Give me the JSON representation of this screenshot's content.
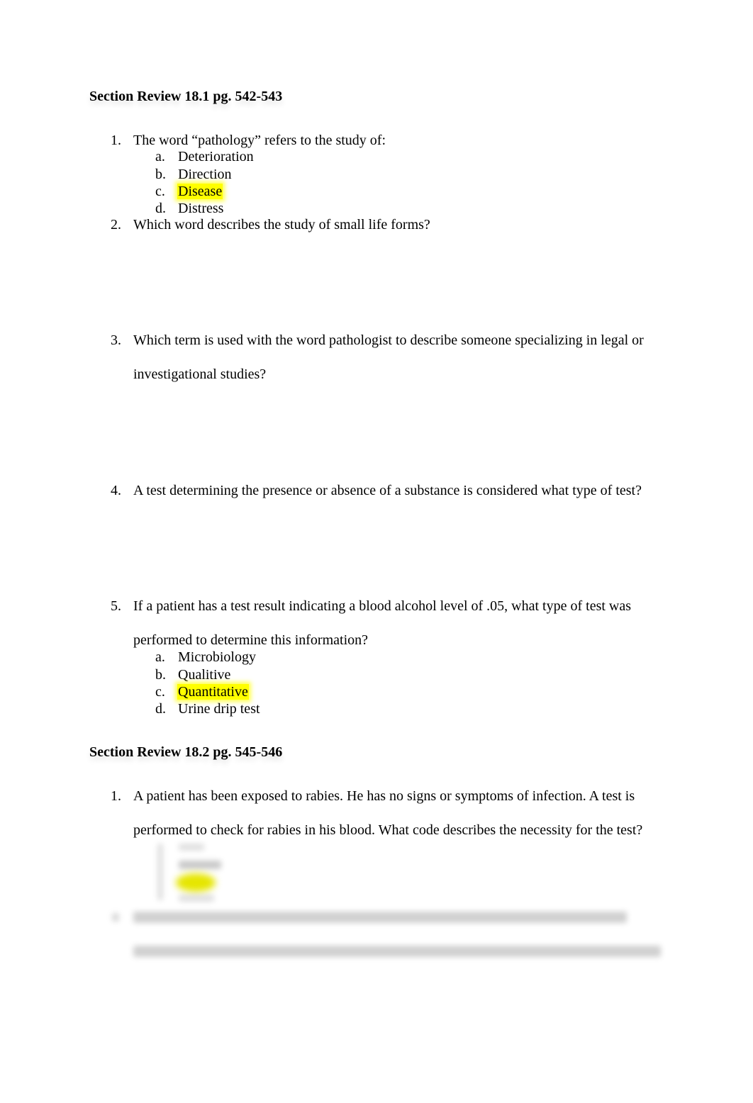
{
  "sections": [
    {
      "heading": "Section Review 18.1 pg. 542-543",
      "questions": [
        {
          "number": "1.",
          "lines": [
            "The word “pathology” refers to the study of:"
          ],
          "options": [
            {
              "letter": "a.",
              "text": "Deterioration",
              "highlighted": false
            },
            {
              "letter": "b.",
              "text": "Direction",
              "highlighted": false
            },
            {
              "letter": "c.",
              "text": "Disease",
              "highlighted": true
            },
            {
              "letter": "d.",
              "text": "Distress",
              "highlighted": false
            }
          ]
        },
        {
          "number": "2.",
          "lines": [
            "Which word describes the study of small life forms?"
          ]
        },
        {
          "number": "3.",
          "lines": [
            "Which term is used with the word pathologist to describe someone specializing in legal or",
            "investigational studies?"
          ]
        },
        {
          "number": "4.",
          "lines": [
            "A test determining the presence or absence of a substance is considered what type of test?"
          ]
        },
        {
          "number": "5.",
          "lines": [
            "If a patient has a test result indicating a blood alcohol level of .05, what type of test was",
            "performed to determine this information?"
          ],
          "options": [
            {
              "letter": "a.",
              "text": "Microbiology",
              "highlighted": false
            },
            {
              "letter": "b.",
              "text": "Qualitive",
              "highlighted": false
            },
            {
              "letter": "c.",
              "text": "Quantitative",
              "highlighted": true
            },
            {
              "letter": "d.",
              "text": "Urine drip test",
              "highlighted": false
            }
          ]
        }
      ]
    },
    {
      "heading": "Section Review 18.2 pg. 545-546",
      "questions": [
        {
          "number": "1.",
          "lines": [
            "A patient has been exposed to rabies. He has no signs or symptoms of infection. A test is",
            "performed to check for rabies in his blood. What code describes the necessity for the test?"
          ]
        }
      ]
    }
  ],
  "highlight_color": "#ffff00"
}
